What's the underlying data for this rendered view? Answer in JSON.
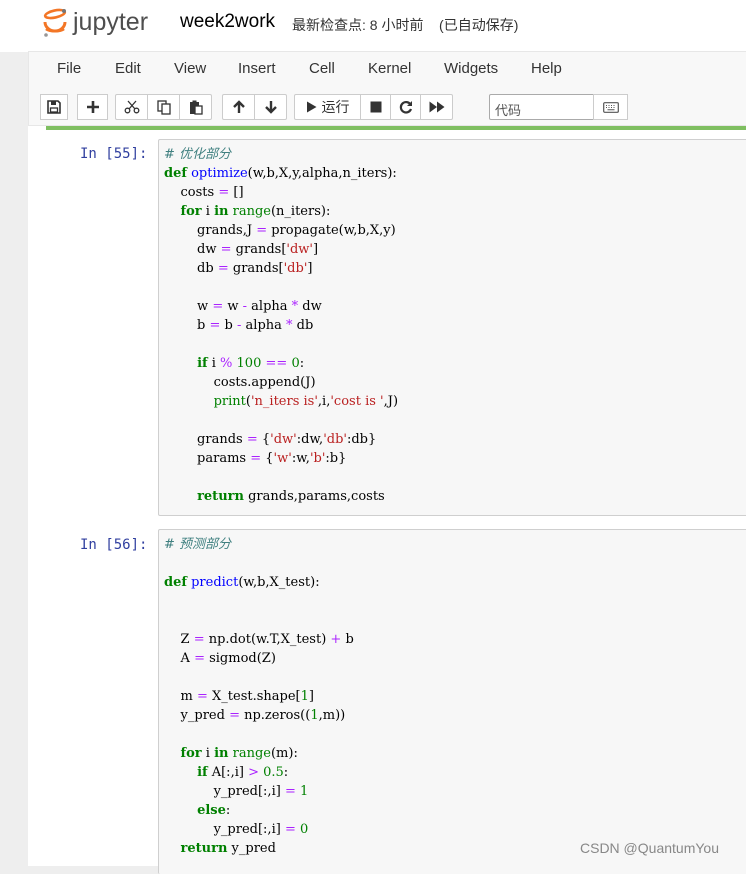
{
  "header": {
    "logo_text": "jupyter",
    "notebook_title": "week2work",
    "checkpoint": "最新检查点: 8 小时前",
    "autosave": "(已自动保存)"
  },
  "menu": [
    "File",
    "Edit",
    "View",
    "Insert",
    "Cell",
    "Kernel",
    "Widgets",
    "Help"
  ],
  "toolbar": {
    "run_label": "运行",
    "cell_type": "代码",
    "icons": [
      "save-icon",
      "plus-icon",
      "scissors-icon",
      "copy-icon",
      "paste-icon",
      "arrow-up-icon",
      "arrow-down-icon",
      "play-icon",
      "stop-icon",
      "restart-icon",
      "fast-forward-icon",
      "keyboard-icon"
    ]
  },
  "colors": {
    "selected_bar": "#7fbf61",
    "prompt": "#303f9f",
    "keyword": "#008000",
    "function": "#0000ff",
    "operator": "#aa22ff",
    "string": "#ba2121",
    "comment": "#408080"
  },
  "cells": [
    {
      "prompt": "In [55]:",
      "lines": [
        [
          {
            "t": "# 优化部分",
            "c": "comment"
          }
        ],
        [
          {
            "t": "def",
            "c": "kw"
          },
          {
            "t": " "
          },
          {
            "t": "optimize",
            "c": "fn"
          },
          {
            "t": "(w,b,X,y,alpha,n_iters):"
          }
        ],
        [
          {
            "t": "    costs "
          },
          {
            "t": "=",
            "c": "op"
          },
          {
            "t": " []"
          }
        ],
        [
          {
            "t": "    "
          },
          {
            "t": "for",
            "c": "kw"
          },
          {
            "t": " i "
          },
          {
            "t": "in",
            "c": "kw"
          },
          {
            "t": " "
          },
          {
            "t": "range",
            "c": "bi"
          },
          {
            "t": "(n_iters):"
          }
        ],
        [
          {
            "t": "        grands,J "
          },
          {
            "t": "=",
            "c": "op"
          },
          {
            "t": " propagate(w,b,X,y)"
          }
        ],
        [
          {
            "t": "        dw "
          },
          {
            "t": "=",
            "c": "op"
          },
          {
            "t": " grands["
          },
          {
            "t": "'dw'",
            "c": "str"
          },
          {
            "t": "]"
          }
        ],
        [
          {
            "t": "        db "
          },
          {
            "t": "=",
            "c": "op"
          },
          {
            "t": " grands["
          },
          {
            "t": "'db'",
            "c": "str"
          },
          {
            "t": "]"
          }
        ],
        [
          {
            "t": ""
          }
        ],
        [
          {
            "t": "        w "
          },
          {
            "t": "=",
            "c": "op"
          },
          {
            "t": " w "
          },
          {
            "t": "-",
            "c": "op"
          },
          {
            "t": " alpha "
          },
          {
            "t": "*",
            "c": "op"
          },
          {
            "t": " dw"
          }
        ],
        [
          {
            "t": "        b "
          },
          {
            "t": "=",
            "c": "op"
          },
          {
            "t": " b "
          },
          {
            "t": "-",
            "c": "op"
          },
          {
            "t": " alpha "
          },
          {
            "t": "*",
            "c": "op"
          },
          {
            "t": " db"
          }
        ],
        [
          {
            "t": ""
          }
        ],
        [
          {
            "t": "        "
          },
          {
            "t": "if",
            "c": "kw"
          },
          {
            "t": " i "
          },
          {
            "t": "%",
            "c": "op"
          },
          {
            "t": " "
          },
          {
            "t": "100",
            "c": "num"
          },
          {
            "t": " "
          },
          {
            "t": "==",
            "c": "op"
          },
          {
            "t": " "
          },
          {
            "t": "0",
            "c": "num"
          },
          {
            "t": ":"
          }
        ],
        [
          {
            "t": "            costs.append(J)"
          }
        ],
        [
          {
            "t": "            "
          },
          {
            "t": "print",
            "c": "bi"
          },
          {
            "t": "("
          },
          {
            "t": "'n_iters is'",
            "c": "str"
          },
          {
            "t": ",i,"
          },
          {
            "t": "'cost is '",
            "c": "str"
          },
          {
            "t": ",J)"
          }
        ],
        [
          {
            "t": ""
          }
        ],
        [
          {
            "t": "        grands "
          },
          {
            "t": "=",
            "c": "op"
          },
          {
            "t": " {"
          },
          {
            "t": "'dw'",
            "c": "str"
          },
          {
            "t": ":dw,"
          },
          {
            "t": "'db'",
            "c": "str"
          },
          {
            "t": ":db}"
          }
        ],
        [
          {
            "t": "        params "
          },
          {
            "t": "=",
            "c": "op"
          },
          {
            "t": " {"
          },
          {
            "t": "'w'",
            "c": "str"
          },
          {
            "t": ":w,"
          },
          {
            "t": "'b'",
            "c": "str"
          },
          {
            "t": ":b}"
          }
        ],
        [
          {
            "t": ""
          }
        ],
        [
          {
            "t": "        "
          },
          {
            "t": "return",
            "c": "kw"
          },
          {
            "t": " grands,params,costs"
          }
        ]
      ]
    },
    {
      "prompt": "In [56]:",
      "lines": [
        [
          {
            "t": "# 预测部分",
            "c": "comment"
          }
        ],
        [
          {
            "t": ""
          }
        ],
        [
          {
            "t": "def",
            "c": "kw"
          },
          {
            "t": " "
          },
          {
            "t": "predict",
            "c": "fn"
          },
          {
            "t": "(w,b,X_test):"
          }
        ],
        [
          {
            "t": ""
          }
        ],
        [
          {
            "t": ""
          }
        ],
        [
          {
            "t": "    Z "
          },
          {
            "t": "=",
            "c": "op"
          },
          {
            "t": " np.dot(w.T,X_test) "
          },
          {
            "t": "+",
            "c": "op"
          },
          {
            "t": " b"
          }
        ],
        [
          {
            "t": "    A "
          },
          {
            "t": "=",
            "c": "op"
          },
          {
            "t": " sigmod(Z)"
          }
        ],
        [
          {
            "t": ""
          }
        ],
        [
          {
            "t": "    m "
          },
          {
            "t": "=",
            "c": "op"
          },
          {
            "t": " X_test.shape["
          },
          {
            "t": "1",
            "c": "num"
          },
          {
            "t": "]"
          }
        ],
        [
          {
            "t": "    y_pred "
          },
          {
            "t": "=",
            "c": "op"
          },
          {
            "t": " np.zeros(("
          },
          {
            "t": "1",
            "c": "num"
          },
          {
            "t": ",m))"
          }
        ],
        [
          {
            "t": ""
          }
        ],
        [
          {
            "t": "    "
          },
          {
            "t": "for",
            "c": "kw"
          },
          {
            "t": " i "
          },
          {
            "t": "in",
            "c": "kw"
          },
          {
            "t": " "
          },
          {
            "t": "range",
            "c": "bi"
          },
          {
            "t": "(m):"
          }
        ],
        [
          {
            "t": "        "
          },
          {
            "t": "if",
            "c": "kw"
          },
          {
            "t": " A[:,i] "
          },
          {
            "t": ">",
            "c": "op"
          },
          {
            "t": " "
          },
          {
            "t": "0.5",
            "c": "num"
          },
          {
            "t": ":"
          }
        ],
        [
          {
            "t": "            y_pred[:,i] "
          },
          {
            "t": "=",
            "c": "op"
          },
          {
            "t": " "
          },
          {
            "t": "1",
            "c": "num"
          }
        ],
        [
          {
            "t": "        "
          },
          {
            "t": "else",
            "c": "kw"
          },
          {
            "t": ":"
          }
        ],
        [
          {
            "t": "            y_pred[:,i] "
          },
          {
            "t": "=",
            "c": "op"
          },
          {
            "t": " "
          },
          {
            "t": "0",
            "c": "num"
          }
        ],
        [
          {
            "t": "    "
          },
          {
            "t": "return",
            "c": "kw"
          },
          {
            "t": " y_pred"
          }
        ]
      ]
    }
  ],
  "watermark": "CSDN @QuantumYou"
}
